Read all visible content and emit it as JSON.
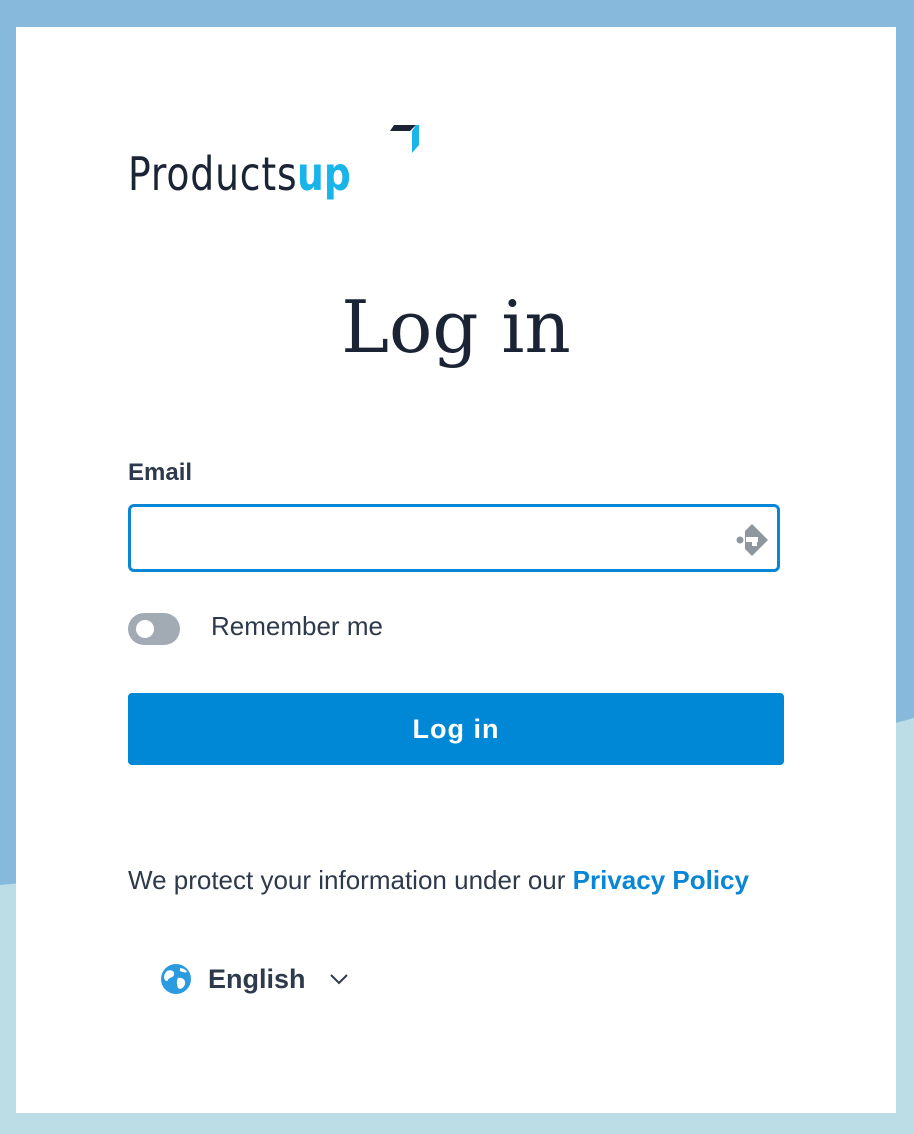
{
  "brand": {
    "name_part1": "Products",
    "name_part2": "up",
    "primary_color": "#1a2435",
    "accent_color": "#19b5ea"
  },
  "page": {
    "heading": "Log in",
    "background_color": "#86b9dc",
    "wave_color": "#bcdde5"
  },
  "form": {
    "email": {
      "label": "Email",
      "value": "",
      "placeholder": "",
      "icon": "autofill-key-icon"
    },
    "remember": {
      "label": "Remember me",
      "checked": false
    },
    "submit": {
      "label": "Log in",
      "color": "#0087d6"
    }
  },
  "footer": {
    "privacy_text": "We protect your information under our",
    "privacy_link": "Privacy Policy",
    "language": {
      "icon": "globe-icon",
      "selected": "English"
    }
  }
}
